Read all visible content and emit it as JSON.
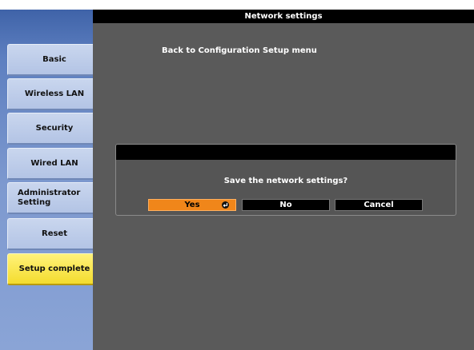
{
  "window": {
    "title": "Network settings"
  },
  "sidebar": {
    "items": [
      {
        "label": "Basic"
      },
      {
        "label": "Wireless LAN"
      },
      {
        "label": "Security"
      },
      {
        "label": "Wired LAN"
      },
      {
        "label": "Administrator Setting"
      },
      {
        "label": "Reset"
      },
      {
        "label": "Setup complete",
        "active": true
      }
    ]
  },
  "main": {
    "back_link": "Back to Configuration Setup menu"
  },
  "dialog": {
    "message": "Save the network settings?",
    "buttons": {
      "yes": "Yes",
      "no": "No",
      "cancel": "Cancel"
    },
    "selected": "yes"
  },
  "colors": {
    "accent": "#f0861a",
    "active_tab": "#f4dc2e",
    "sidebar": "#6f8fcc",
    "panel_bg": "#5a5a5a"
  },
  "icons": {
    "enter": "enter-icon"
  }
}
